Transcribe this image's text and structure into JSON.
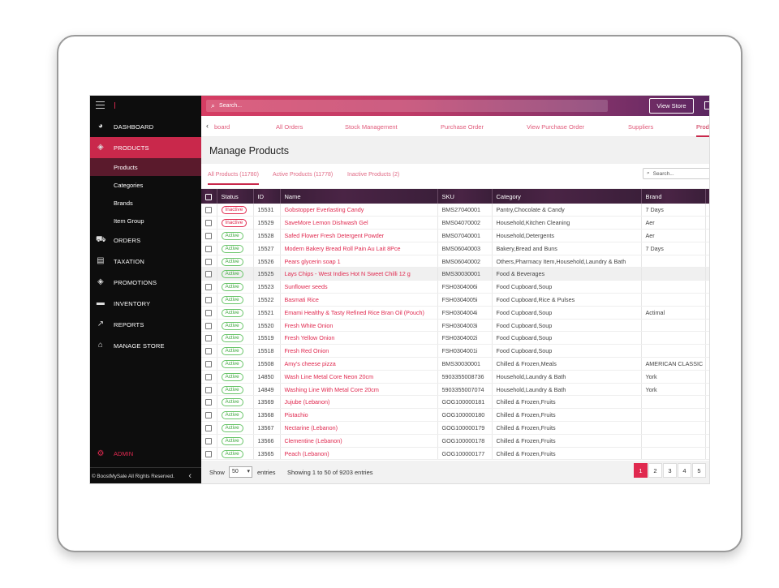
{
  "sidebar": {
    "brand_icon": "hamburger-menu-icon",
    "nav": [
      {
        "label": "DASHBOARD",
        "icon": "dashboard-icon"
      },
      {
        "label": "PRODUCTS",
        "icon": "products-box-icon",
        "active": true
      },
      {
        "label": "ORDERS",
        "icon": "cart-icon"
      },
      {
        "label": "TAXATION",
        "icon": "taxation-icon"
      },
      {
        "label": "PROMOTIONS",
        "icon": "promotions-icon"
      },
      {
        "label": "INVENTORY",
        "icon": "folder-icon"
      },
      {
        "label": "REPORTS",
        "icon": "reports-chart-icon"
      },
      {
        "label": "MANAGE STORE",
        "icon": "store-icon"
      }
    ],
    "sub": [
      "Products",
      "Categories",
      "Brands",
      "Item Group"
    ],
    "admin": "ADMIN",
    "footer": "© BoostMySale All Rights Reserved."
  },
  "topbar": {
    "search_placeholder": "Search...",
    "view_store": "View Store"
  },
  "tabs": [
    "board",
    "All Orders",
    "Stock Management",
    "Purchase Order",
    "View Purchase Order",
    "Suppliers",
    "Prod"
  ],
  "page_title": "Manage Products",
  "filters": [
    "All Products (11780)",
    "Active Products (11778)",
    "Inactive Products (2)"
  ],
  "table_search_placeholder": "Search...",
  "columns": [
    "Status",
    "ID",
    "Name",
    "SKU",
    "Category",
    "Brand"
  ],
  "rows": [
    {
      "status": "Inactive",
      "id": "15531",
      "name": "Gobstopper Everlasting Candy",
      "sku": "BMS27040001",
      "category": "Pantry,Chocolate & Candy",
      "brand": "7 Days"
    },
    {
      "status": "Inactive",
      "id": "15529",
      "name": "SaveMore Lemon Dishwash Gel",
      "sku": "BMS04070002",
      "category": "Household,Kitchen Cleaning",
      "brand": "Aer"
    },
    {
      "status": "Active",
      "id": "15528",
      "name": "Safed Flower Fresh Detergent Powder",
      "sku": "BMS07040001",
      "category": "Household,Detergents",
      "brand": "Aer"
    },
    {
      "status": "Active",
      "id": "15527",
      "name": "Modern Bakery Bread Roll Pain Au Lait 8Pce",
      "sku": "BMS06040003",
      "category": "Bakery,Bread and Buns",
      "brand": "7 Days"
    },
    {
      "status": "Active",
      "id": "15526",
      "name": "Pears glycerin soap 1",
      "sku": "BMS06040002",
      "category": "Others,Pharmacy Item,Household,Laundry & Bath",
      "brand": ""
    },
    {
      "status": "Active",
      "id": "15525",
      "name": "Lays Chips - West Indies Hot N Sweet Chilli 12 g",
      "sku": "BMS30030001",
      "category": "Food & Beverages",
      "brand": ""
    },
    {
      "status": "Active",
      "id": "15523",
      "name": "Sunflower seeds",
      "sku": "FSH0304006i",
      "category": "Food Cupboard,Soup",
      "brand": ""
    },
    {
      "status": "Active",
      "id": "15522",
      "name": "Basmati Rice",
      "sku": "FSH0304005i",
      "category": "Food Cupboard,Rice & Pulses",
      "brand": ""
    },
    {
      "status": "Active",
      "id": "15521",
      "name": "Emami Healthy & Tasty Refined Rice Bran Oil (Pouch)",
      "sku": "FSH0304004i",
      "category": "Food Cupboard,Soup",
      "brand": "Actimal"
    },
    {
      "status": "Active",
      "id": "15520",
      "name": "Fresh White Onion",
      "sku": "FSH0304003i",
      "category": "Food Cupboard,Soup",
      "brand": ""
    },
    {
      "status": "Active",
      "id": "15519",
      "name": "Fresh Yellow Onion",
      "sku": "FSH0304002i",
      "category": "Food Cupboard,Soup",
      "brand": ""
    },
    {
      "status": "Active",
      "id": "15518",
      "name": "Fresh Red Onion",
      "sku": "FSH0304001i",
      "category": "Food Cupboard,Soup",
      "brand": ""
    },
    {
      "status": "Active",
      "id": "15508",
      "name": "Amy's cheese pizza",
      "sku": "BMS30030001",
      "category": "Chilled & Frozen,Meals",
      "brand": "AMERICAN CLASSIC"
    },
    {
      "status": "Active",
      "id": "14850",
      "name": "Wash Line Metal Core Neon 20cm",
      "sku": "5903355008736",
      "category": "Household,Laundry & Bath",
      "brand": "York"
    },
    {
      "status": "Active",
      "id": "14849",
      "name": "Washing Line With Metal Core 20cm",
      "sku": "5903355007074",
      "category": "Household,Laundry & Bath",
      "brand": "York"
    },
    {
      "status": "Active",
      "id": "13569",
      "name": "Jujube (Lebanon)",
      "sku": "GOG100000181",
      "category": "Chilled & Frozen,Fruits",
      "brand": ""
    },
    {
      "status": "Active",
      "id": "13568",
      "name": "Pistachio",
      "sku": "GOG100000180",
      "category": "Chilled & Frozen,Fruits",
      "brand": ""
    },
    {
      "status": "Active",
      "id": "13567",
      "name": "Nectarine (Lebanon)",
      "sku": "GOG100000179",
      "category": "Chilled & Frozen,Fruits",
      "brand": ""
    },
    {
      "status": "Active",
      "id": "13566",
      "name": "Clementine (Lebanon)",
      "sku": "GOG100000178",
      "category": "Chilled & Frozen,Fruits",
      "brand": ""
    },
    {
      "status": "Active",
      "id": "13565",
      "name": "Peach (Lebanon)",
      "sku": "GOG100000177",
      "category": "Chilled & Frozen,Fruits",
      "brand": ""
    }
  ],
  "footer": {
    "show": "Show",
    "page_size": "50",
    "entries": "entries",
    "info": "Showing 1 to 50 of 9203 entries",
    "pages": [
      "1",
      "2",
      "3",
      "4",
      "5"
    ]
  },
  "colors": {
    "accent": "#c9284b",
    "header_dark": "#3a1e38"
  }
}
